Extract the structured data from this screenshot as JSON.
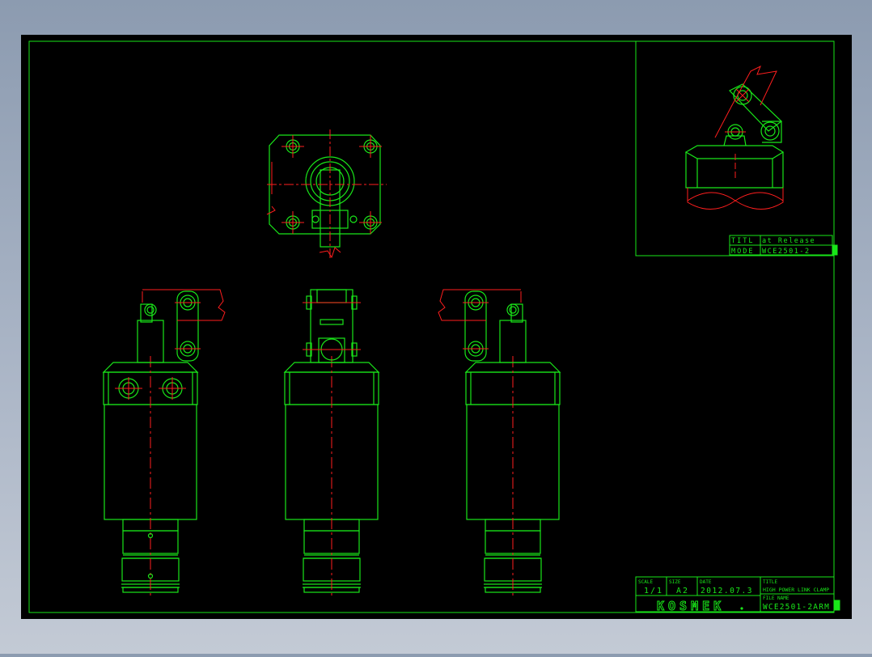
{
  "colors": {
    "line": "#19e619",
    "center": "#ff1e1e",
    "paper": "#000000",
    "text": "#19e619"
  },
  "inset_block": {
    "row1_label": "TITL",
    "row1_value": "at Release",
    "row2_label": "MODE",
    "row2_value": "WCE2501-2"
  },
  "title_block": {
    "scale_label": "SCALE",
    "scale_value": "1/1",
    "size_label": "SIZE",
    "size_value": "A2",
    "date_label": "DATE",
    "date_value": "2012.07.3",
    "title_label": "TITLE",
    "title_value": "HIGH POWER LINK CLAMP",
    "filename_label": "FILE NAME",
    "filename_value": "WCE2501-2ARM",
    "company": "KOSMEK"
  }
}
